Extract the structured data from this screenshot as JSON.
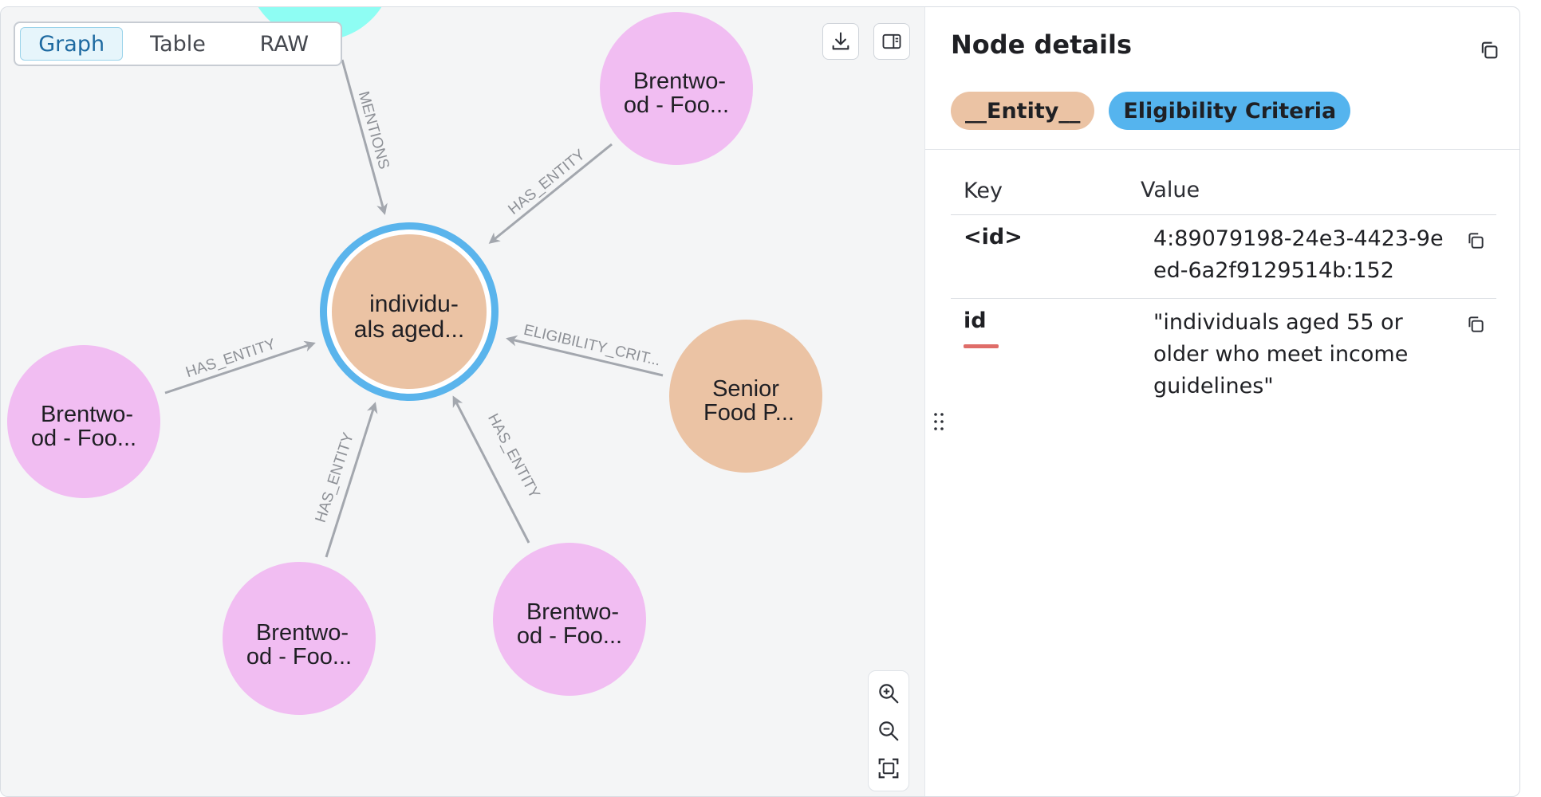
{
  "view_toggle": {
    "tabs": [
      "Graph",
      "Table",
      "RAW"
    ],
    "active": "Graph"
  },
  "colors": {
    "entity_node": "#ebc3a4",
    "document_node": "#f1bdf2",
    "mention_node": "#8efdf3",
    "selected_ring": "#5ab4ec",
    "edge": "#a3a7ae",
    "badge_entity": "#ebc3a4",
    "badge_label": "#55b4ee"
  },
  "graph": {
    "center_node": {
      "line1": "individu-",
      "line2": "als aged..."
    },
    "nodes": [
      {
        "name": "node-brentwood-top",
        "line1": "Brentwo-",
        "line2": "od - Foo..."
      },
      {
        "name": "node-brentwood-left",
        "line1": "Brentwo-",
        "line2": "od - Foo..."
      },
      {
        "name": "node-senior-food",
        "line1": "Senior",
        "line2": "Food P..."
      },
      {
        "name": "node-brentwood-bottom-left",
        "line1": "Brentwo-",
        "line2": "od - Foo..."
      },
      {
        "name": "node-brentwood-bottom-right",
        "line1": "Brentwo-",
        "line2": "od - Foo..."
      }
    ],
    "edges": [
      "MENTIONS",
      "HAS_ENTITY",
      "HAS_ENTITY",
      "ELIGIBILITY_CRIT...",
      "HAS_ENTITY",
      "HAS_ENTITY"
    ]
  },
  "toolbar": {
    "download_icon": "download-icon",
    "panel_icon": "side-panel-icon"
  },
  "zoom": {
    "zoom_in": "zoom-in-icon",
    "zoom_out": "zoom-out-icon",
    "fit": "fit-to-screen-icon"
  },
  "details": {
    "title": "Node details",
    "badges": [
      "__Entity__",
      "Eligibility Criteria"
    ],
    "table_headers": {
      "key": "Key",
      "value": "Value"
    },
    "properties": [
      {
        "key": "<id>",
        "value": "4:89079198-24e3-4423-9eed-6a2f9129514b:152"
      },
      {
        "key": "id",
        "value": "\"individuals aged 55 or older who meet income guidelines\""
      }
    ]
  }
}
